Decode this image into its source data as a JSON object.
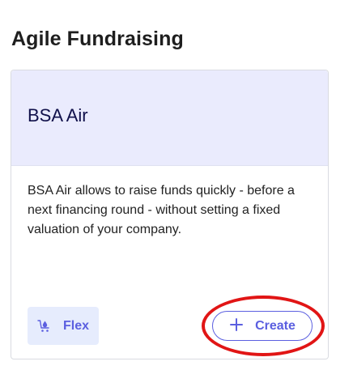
{
  "section": {
    "title": "Agile Fundraising"
  },
  "card": {
    "title": "BSA Air",
    "description": "BSA Air allows to raise funds quickly - before a next financing round - without setting a fixed valuation of your company.",
    "badge": {
      "label": "Flex",
      "icon": "cart-drop-icon"
    },
    "create_button": {
      "label": "Create",
      "icon": "plus-icon"
    }
  },
  "colors": {
    "accent": "#5b5fe0",
    "header_bg": "#eaebfd",
    "badge_bg": "#e6ecfd",
    "annotation_ring": "#e11515"
  }
}
